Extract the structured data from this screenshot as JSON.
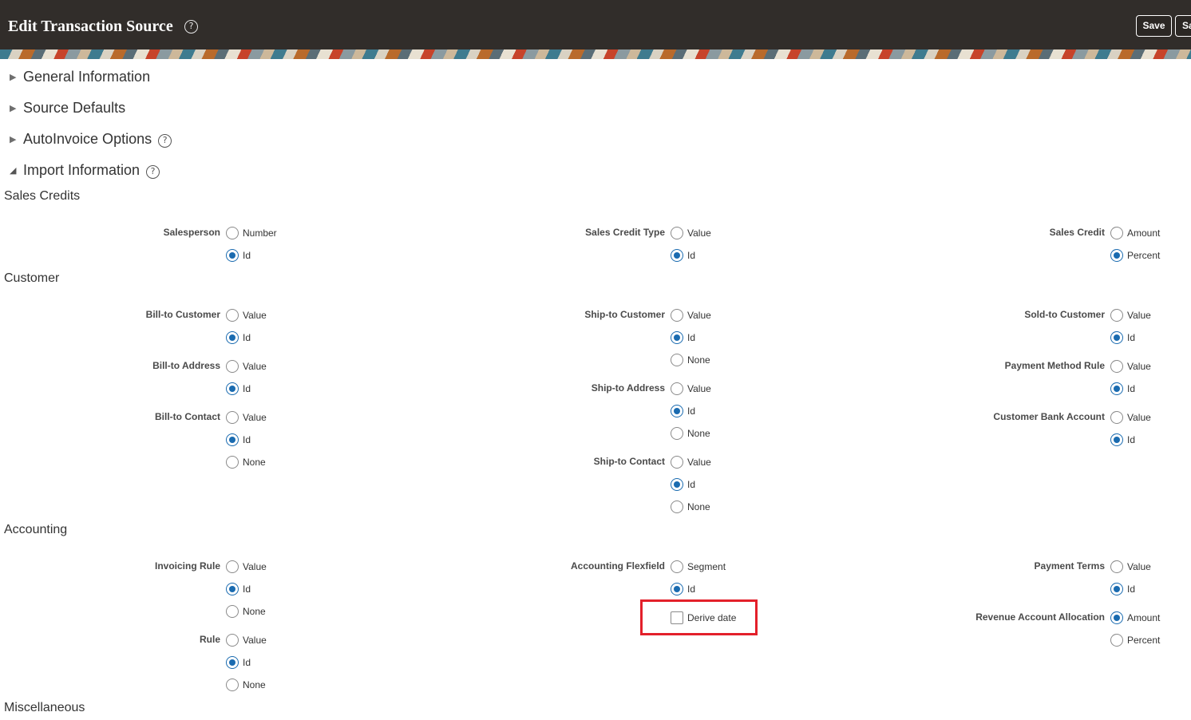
{
  "header": {
    "title": "Edit Transaction Source",
    "buttons": {
      "save": "Save",
      "save_close_partial": "Sa"
    }
  },
  "sections": {
    "general": "General Information",
    "defaults": "Source Defaults",
    "autoinvoice": "AutoInvoice Options",
    "import": "Import Information"
  },
  "import": {
    "sales_credits": {
      "heading": "Sales Credits",
      "salesperson": {
        "label": "Salesperson",
        "options": [
          "Number",
          "Id"
        ],
        "selected": "Id"
      },
      "sales_credit_type": {
        "label": "Sales Credit Type",
        "options": [
          "Value",
          "Id"
        ],
        "selected": "Id"
      },
      "sales_credit": {
        "label": "Sales Credit",
        "options": [
          "Amount",
          "Percent"
        ],
        "selected": "Percent"
      }
    },
    "customer": {
      "heading": "Customer",
      "bill_to_customer": {
        "label": "Bill-to Customer",
        "options": [
          "Value",
          "Id"
        ],
        "selected": "Id"
      },
      "bill_to_address": {
        "label": "Bill-to Address",
        "options": [
          "Value",
          "Id"
        ],
        "selected": "Id"
      },
      "bill_to_contact": {
        "label": "Bill-to Contact",
        "options": [
          "Value",
          "Id",
          "None"
        ],
        "selected": "Id"
      },
      "ship_to_customer": {
        "label": "Ship-to Customer",
        "options": [
          "Value",
          "Id",
          "None"
        ],
        "selected": "Id"
      },
      "ship_to_address": {
        "label": "Ship-to Address",
        "options": [
          "Value",
          "Id",
          "None"
        ],
        "selected": "Id"
      },
      "ship_to_contact": {
        "label": "Ship-to Contact",
        "options": [
          "Value",
          "Id",
          "None"
        ],
        "selected": "Id"
      },
      "sold_to_customer": {
        "label": "Sold-to Customer",
        "options": [
          "Value",
          "Id"
        ],
        "selected": "Id"
      },
      "payment_method_rule": {
        "label": "Payment Method Rule",
        "options": [
          "Value",
          "Id"
        ],
        "selected": "Id"
      },
      "customer_bank_account": {
        "label": "Customer Bank Account",
        "options": [
          "Value",
          "Id"
        ],
        "selected": "Id"
      }
    },
    "accounting": {
      "heading": "Accounting",
      "invoicing_rule": {
        "label": "Invoicing Rule",
        "options": [
          "Value",
          "Id",
          "None"
        ],
        "selected": "Id"
      },
      "rule": {
        "label": "Rule",
        "options": [
          "Value",
          "Id",
          "None"
        ],
        "selected": "Id"
      },
      "accounting_flexfield": {
        "label": "Accounting Flexfield",
        "options": [
          "Segment",
          "Id"
        ],
        "selected": "Id"
      },
      "derive_date": {
        "label": "Derive date",
        "checked": false
      },
      "payment_terms": {
        "label": "Payment Terms",
        "options": [
          "Value",
          "Id"
        ],
        "selected": "Id"
      },
      "revenue_account_allocation": {
        "label": "Revenue Account Allocation",
        "options": [
          "Amount",
          "Percent"
        ],
        "selected": "Amount"
      }
    },
    "miscellaneous": {
      "heading": "Miscellaneous"
    }
  },
  "colors": {
    "header_bg": "#312d2a",
    "accent": "#1a6bb0",
    "highlight": "#e3202a"
  }
}
